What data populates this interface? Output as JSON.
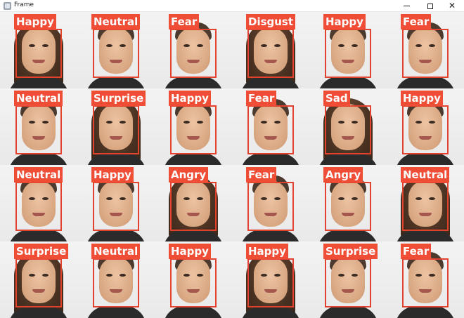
{
  "window": {
    "title": "Frame",
    "minimize_icon": "minimize-icon",
    "maximize_icon": "maximize-icon",
    "close_icon": "close-icon"
  },
  "colors": {
    "box": "#e2432f",
    "label_bg": "#ef4d36",
    "label_text": "#ffffff"
  },
  "faces": [
    {
      "emotion": "Happy",
      "gender": "female"
    },
    {
      "emotion": "Neutral",
      "gender": "male"
    },
    {
      "emotion": "Fear",
      "gender": "male"
    },
    {
      "emotion": "Disgust",
      "gender": "female"
    },
    {
      "emotion": "Happy",
      "gender": "male"
    },
    {
      "emotion": "Fear",
      "gender": "male"
    },
    {
      "emotion": "Neutral",
      "gender": "male"
    },
    {
      "emotion": "Surprise",
      "gender": "female"
    },
    {
      "emotion": "Happy",
      "gender": "male"
    },
    {
      "emotion": "Fear",
      "gender": "male"
    },
    {
      "emotion": "Sad",
      "gender": "female"
    },
    {
      "emotion": "Happy",
      "gender": "male"
    },
    {
      "emotion": "Neutral",
      "gender": "male"
    },
    {
      "emotion": "Happy",
      "gender": "male"
    },
    {
      "emotion": "Angry",
      "gender": "female"
    },
    {
      "emotion": "Fear",
      "gender": "male"
    },
    {
      "emotion": "Angry",
      "gender": "male"
    },
    {
      "emotion": "Neutral",
      "gender": "female"
    },
    {
      "emotion": "Surprise",
      "gender": "female"
    },
    {
      "emotion": "Neutral",
      "gender": "male"
    },
    {
      "emotion": "Happy",
      "gender": "male"
    },
    {
      "emotion": "Happy",
      "gender": "female"
    },
    {
      "emotion": "Surprise",
      "gender": "male"
    },
    {
      "emotion": "Fear",
      "gender": "male"
    }
  ]
}
